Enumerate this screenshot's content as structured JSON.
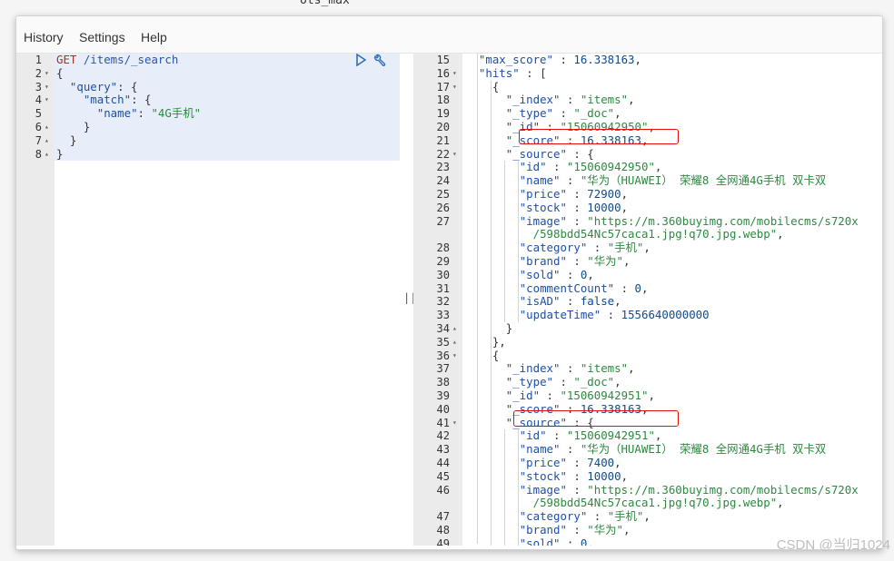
{
  "top_fragment": "ots_max",
  "menu": {
    "history": "History",
    "settings": "Settings",
    "help": "Help"
  },
  "request": {
    "lines": [
      {
        "n": "1",
        "fold": "",
        "tokens": [
          [
            "kw",
            "GET "
          ],
          [
            "url",
            "/items/_search"
          ]
        ]
      },
      {
        "n": "2",
        "fold": "▾",
        "tokens": [
          [
            "p",
            "{"
          ]
        ]
      },
      {
        "n": "3",
        "fold": "▾",
        "tokens": [
          [
            "p",
            "  "
          ],
          [
            "k",
            "\"query\""
          ],
          [
            "p",
            ": {"
          ]
        ]
      },
      {
        "n": "4",
        "fold": "▾",
        "tokens": [
          [
            "p",
            "    "
          ],
          [
            "k",
            "\"match\""
          ],
          [
            "p",
            ": {"
          ]
        ]
      },
      {
        "n": "5",
        "fold": "",
        "tokens": [
          [
            "p",
            "      "
          ],
          [
            "k",
            "\"name\""
          ],
          [
            "p",
            ": "
          ],
          [
            "s",
            "\"4G手机\""
          ]
        ]
      },
      {
        "n": "6",
        "fold": "▴",
        "tokens": [
          [
            "p",
            "    }"
          ]
        ]
      },
      {
        "n": "7",
        "fold": "▴",
        "tokens": [
          [
            "p",
            "  }"
          ]
        ]
      },
      {
        "n": "8",
        "fold": "▴",
        "tokens": [
          [
            "p",
            "}"
          ]
        ]
      }
    ]
  },
  "response": {
    "lines": [
      {
        "n": "15",
        "fold": "",
        "tokens": [
          [
            "p",
            "  "
          ],
          [
            "k",
            "\"max_score\""
          ],
          [
            "p",
            " : "
          ],
          [
            "n",
            "16.338163"
          ],
          [
            "p",
            ","
          ]
        ]
      },
      {
        "n": "16",
        "fold": "▾",
        "tokens": [
          [
            "p",
            "  "
          ],
          [
            "k",
            "\"hits\""
          ],
          [
            "p",
            " : ["
          ]
        ]
      },
      {
        "n": "17",
        "fold": "▾",
        "tokens": [
          [
            "p",
            "    {"
          ]
        ]
      },
      {
        "n": "18",
        "fold": "",
        "tokens": [
          [
            "p",
            "      "
          ],
          [
            "k",
            "\"_index\""
          ],
          [
            "p",
            " : "
          ],
          [
            "s",
            "\"items\""
          ],
          [
            "p",
            ","
          ]
        ]
      },
      {
        "n": "19",
        "fold": "",
        "tokens": [
          [
            "p",
            "      "
          ],
          [
            "k",
            "\"_type\""
          ],
          [
            "p",
            " : "
          ],
          [
            "s",
            "\"_doc\""
          ],
          [
            "p",
            ","
          ]
        ]
      },
      {
        "n": "20",
        "fold": "",
        "tokens": [
          [
            "p",
            "      "
          ],
          [
            "k",
            "\"_id\""
          ],
          [
            "p",
            " : "
          ],
          [
            "s",
            "\"15060942950\""
          ],
          [
            "p",
            ","
          ]
        ]
      },
      {
        "n": "21",
        "fold": "",
        "tokens": [
          [
            "p",
            "      "
          ],
          [
            "k",
            "\"_score\""
          ],
          [
            "p",
            " : "
          ],
          [
            "n",
            "16.338163"
          ],
          [
            "p",
            ","
          ]
        ]
      },
      {
        "n": "22",
        "fold": "▾",
        "tokens": [
          [
            "p",
            "      "
          ],
          [
            "k",
            "\"_source\""
          ],
          [
            "p",
            " : {"
          ]
        ]
      },
      {
        "n": "23",
        "fold": "",
        "tokens": [
          [
            "p",
            "        "
          ],
          [
            "k",
            "\"id\""
          ],
          [
            "p",
            " : "
          ],
          [
            "s",
            "\"15060942950\""
          ],
          [
            "p",
            ","
          ]
        ]
      },
      {
        "n": "24",
        "fold": "",
        "tokens": [
          [
            "p",
            "        "
          ],
          [
            "k",
            "\"name\""
          ],
          [
            "p",
            " : "
          ],
          [
            "s",
            "\"华为（HUAWEI） 荣耀8 全网通4G手机 双卡双"
          ]
        ]
      },
      {
        "n": "25",
        "fold": "",
        "tokens": [
          [
            "p",
            "        "
          ],
          [
            "k",
            "\"price\""
          ],
          [
            "p",
            " : "
          ],
          [
            "n",
            "72900"
          ],
          [
            "p",
            ","
          ]
        ]
      },
      {
        "n": "26",
        "fold": "",
        "tokens": [
          [
            "p",
            "        "
          ],
          [
            "k",
            "\"stock\""
          ],
          [
            "p",
            " : "
          ],
          [
            "n",
            "10000"
          ],
          [
            "p",
            ","
          ]
        ]
      },
      {
        "n": "27",
        "fold": "",
        "tokens": [
          [
            "p",
            "        "
          ],
          [
            "k",
            "\"image\""
          ],
          [
            "p",
            " : "
          ],
          [
            "s",
            "\"https://m.360buyimg.com/mobilecms/s720x"
          ]
        ]
      },
      {
        "n": "",
        "fold": "",
        "tokens": [
          [
            "p",
            "          "
          ],
          [
            "s",
            "/598bdd54Nc57caca1.jpg!q70.jpg.webp\""
          ],
          [
            "p",
            ","
          ]
        ]
      },
      {
        "n": "28",
        "fold": "",
        "tokens": [
          [
            "p",
            "        "
          ],
          [
            "k",
            "\"category\""
          ],
          [
            "p",
            " : "
          ],
          [
            "s",
            "\"手机\""
          ],
          [
            "p",
            ","
          ]
        ]
      },
      {
        "n": "29",
        "fold": "",
        "tokens": [
          [
            "p",
            "        "
          ],
          [
            "k",
            "\"brand\""
          ],
          [
            "p",
            " : "
          ],
          [
            "s",
            "\"华为\""
          ],
          [
            "p",
            ","
          ]
        ]
      },
      {
        "n": "30",
        "fold": "",
        "tokens": [
          [
            "p",
            "        "
          ],
          [
            "k",
            "\"sold\""
          ],
          [
            "p",
            " : "
          ],
          [
            "n",
            "0"
          ],
          [
            "p",
            ","
          ]
        ]
      },
      {
        "n": "31",
        "fold": "",
        "tokens": [
          [
            "p",
            "        "
          ],
          [
            "k",
            "\"commentCount\""
          ],
          [
            "p",
            " : "
          ],
          [
            "n",
            "0"
          ],
          [
            "p",
            ","
          ]
        ]
      },
      {
        "n": "32",
        "fold": "",
        "tokens": [
          [
            "p",
            "        "
          ],
          [
            "k",
            "\"isAD\""
          ],
          [
            "p",
            " : "
          ],
          [
            "b",
            "false"
          ],
          [
            "p",
            ","
          ]
        ]
      },
      {
        "n": "33",
        "fold": "",
        "tokens": [
          [
            "p",
            "        "
          ],
          [
            "k",
            "\"updateTime\""
          ],
          [
            "p",
            " : "
          ],
          [
            "n",
            "1556640000000"
          ]
        ]
      },
      {
        "n": "34",
        "fold": "▴",
        "tokens": [
          [
            "p",
            "      }"
          ]
        ]
      },
      {
        "n": "35",
        "fold": "▴",
        "tokens": [
          [
            "p",
            "    },"
          ]
        ]
      },
      {
        "n": "36",
        "fold": "▾",
        "tokens": [
          [
            "p",
            "    {"
          ]
        ]
      },
      {
        "n": "37",
        "fold": "",
        "tokens": [
          [
            "p",
            "      "
          ],
          [
            "k",
            "\"_index\""
          ],
          [
            "p",
            " : "
          ],
          [
            "s",
            "\"items\""
          ],
          [
            "p",
            ","
          ]
        ]
      },
      {
        "n": "38",
        "fold": "",
        "tokens": [
          [
            "p",
            "      "
          ],
          [
            "k",
            "\"_type\""
          ],
          [
            "p",
            " : "
          ],
          [
            "s",
            "\"_doc\""
          ],
          [
            "p",
            ","
          ]
        ]
      },
      {
        "n": "39",
        "fold": "",
        "tokens": [
          [
            "p",
            "      "
          ],
          [
            "k",
            "\"_id\""
          ],
          [
            "p",
            " : "
          ],
          [
            "s",
            "\"15060942951\""
          ],
          [
            "p",
            ","
          ]
        ]
      },
      {
        "n": "40",
        "fold": "",
        "tokens": [
          [
            "p",
            "      "
          ],
          [
            "k",
            "\"_score\""
          ],
          [
            "p",
            " : "
          ],
          [
            "n",
            "16.338163"
          ],
          [
            "p",
            ","
          ]
        ]
      },
      {
        "n": "41",
        "fold": "▾",
        "tokens": [
          [
            "p",
            "      "
          ],
          [
            "k",
            "\"_source\""
          ],
          [
            "p",
            " : {"
          ]
        ]
      },
      {
        "n": "42",
        "fold": "",
        "tokens": [
          [
            "p",
            "        "
          ],
          [
            "k",
            "\"id\""
          ],
          [
            "p",
            " : "
          ],
          [
            "s",
            "\"15060942951\""
          ],
          [
            "p",
            ","
          ]
        ]
      },
      {
        "n": "43",
        "fold": "",
        "tokens": [
          [
            "p",
            "        "
          ],
          [
            "k",
            "\"name\""
          ],
          [
            "p",
            " : "
          ],
          [
            "s",
            "\"华为（HUAWEI） 荣耀8 全网通4G手机 双卡双"
          ]
        ]
      },
      {
        "n": "44",
        "fold": "",
        "tokens": [
          [
            "p",
            "        "
          ],
          [
            "k",
            "\"price\""
          ],
          [
            "p",
            " : "
          ],
          [
            "n",
            "7400"
          ],
          [
            "p",
            ","
          ]
        ]
      },
      {
        "n": "45",
        "fold": "",
        "tokens": [
          [
            "p",
            "        "
          ],
          [
            "k",
            "\"stock\""
          ],
          [
            "p",
            " : "
          ],
          [
            "n",
            "10000"
          ],
          [
            "p",
            ","
          ]
        ]
      },
      {
        "n": "46",
        "fold": "",
        "tokens": [
          [
            "p",
            "        "
          ],
          [
            "k",
            "\"image\""
          ],
          [
            "p",
            " : "
          ],
          [
            "s",
            "\"https://m.360buyimg.com/mobilecms/s720x"
          ]
        ]
      },
      {
        "n": "",
        "fold": "",
        "tokens": [
          [
            "p",
            "          "
          ],
          [
            "s",
            "/598bdd54Nc57caca1.jpg!q70.jpg.webp\""
          ],
          [
            "p",
            ","
          ]
        ]
      },
      {
        "n": "47",
        "fold": "",
        "tokens": [
          [
            "p",
            "        "
          ],
          [
            "k",
            "\"category\""
          ],
          [
            "p",
            " : "
          ],
          [
            "s",
            "\"手机\""
          ],
          [
            "p",
            ","
          ]
        ]
      },
      {
        "n": "48",
        "fold": "",
        "tokens": [
          [
            "p",
            "        "
          ],
          [
            "k",
            "\"brand\""
          ],
          [
            "p",
            " : "
          ],
          [
            "s",
            "\"华为\""
          ],
          [
            "p",
            ","
          ]
        ]
      },
      {
        "n": "49",
        "fold": "",
        "tokens": [
          [
            "p",
            "        "
          ],
          [
            "k",
            "\"sold\""
          ],
          [
            "p",
            " : "
          ],
          [
            "n",
            "0"
          ],
          [
            "p",
            ","
          ]
        ]
      }
    ]
  },
  "divider_label": "||",
  "watermark": "CSDN @当归1024",
  "colors": {
    "highlight": "#e01010",
    "run_icon": "#2f6fb8"
  }
}
